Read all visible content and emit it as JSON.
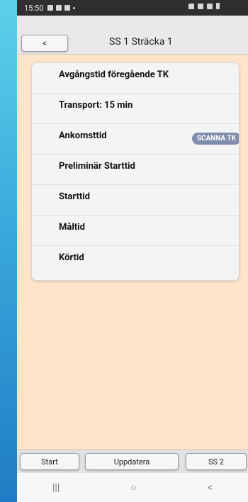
{
  "status": {
    "time": "15:50"
  },
  "header": {
    "back_label": "<",
    "title": "SS 1 Sträcka 1"
  },
  "rows": [
    {
      "label": "Avgångstid föregående TK"
    },
    {
      "label": "Transport: 15 min"
    },
    {
      "label": "Ankomsttid",
      "action": "SCANNA TK"
    },
    {
      "label": "Preliminär Starttid"
    },
    {
      "label": "Starttid"
    },
    {
      "label": "Måltid"
    },
    {
      "label": "Körtid"
    }
  ],
  "toolbar": {
    "start_label": "Start",
    "update_label": "Uppdatera",
    "next_label": "SS 2"
  },
  "navbar": {
    "recent_glyph": "|||",
    "home_glyph": "○",
    "back_glyph": "<"
  },
  "colors": {
    "background": "#ffe4c9",
    "scan_button": "#7e8dab",
    "status_bar": "#2f2f30"
  }
}
